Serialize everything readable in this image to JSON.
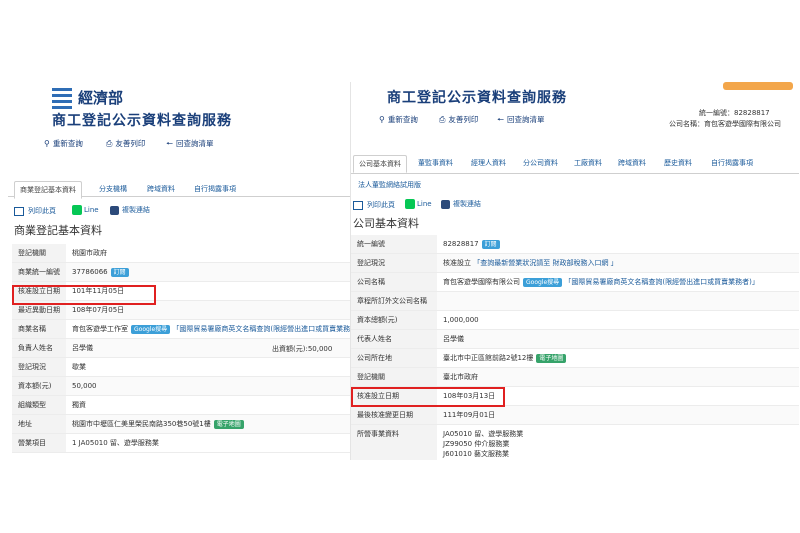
{
  "left": {
    "ministry": "經濟部",
    "service_title": "商工登記公示資料查詢服務",
    "toolbar": {
      "requery": "重新查詢",
      "friendly_print": "友善列印",
      "back_list": "回查詢清單"
    },
    "tabs": [
      "商業登記基本資料",
      "分支機構",
      "跨域資料",
      "自行揭露事項"
    ],
    "actions": {
      "print": "列印此頁",
      "line": "Line",
      "copy": "複製連結"
    },
    "section_title": "商業登記基本資料",
    "rows": [
      {
        "key": "登記機關",
        "value": "桃園市政府"
      },
      {
        "key": "商業統一編號",
        "value": "37786066",
        "badge": "訂閱"
      },
      {
        "key": "核准設立日期",
        "value": "101年11月05日"
      },
      {
        "key": "最近異動日期",
        "value": "108年07月05日"
      },
      {
        "key": "商業名稱",
        "value": "育包客遊學工作室",
        "badge": "Google搜尋",
        "extra": "「國際貿易署廠商英文名稱查詢(限經營出進口或買賣業務者)」"
      },
      {
        "key": "負責人姓名",
        "value": "呂學儀",
        "extra": "出資額(元):50,000"
      },
      {
        "key": "登記現況",
        "value": "歇業"
      },
      {
        "key": "資本額(元)",
        "value": "50,000"
      },
      {
        "key": "組織類型",
        "value": "獨資"
      },
      {
        "key": "地址",
        "value": "桃園市中壢區仁美里榮民南路350巷50號1樓",
        "badge": "電子地圖"
      },
      {
        "key": "營業項目",
        "value": "1 JA05010 留、遊學服務業"
      }
    ]
  },
  "right": {
    "service_title": "商工登記公示資料查詢服務",
    "toolbar": {
      "requery": "重新查詢",
      "friendly_print": "友善列印",
      "back_list": "回查詢清單"
    },
    "header_info": {
      "id_label": "統一編號：82828817",
      "name_label": "公司名稱：育包客遊學國際有限公司"
    },
    "tabs": [
      "公司基本資料",
      "董監事資料",
      "經理人資料",
      "分公司資料",
      "工廠資料",
      "跨域資料",
      "歷史資料",
      "自行揭露事項",
      "法人董監網絡試用版"
    ],
    "actions": {
      "print": "列印此頁",
      "line": "Line",
      "copy": "複製連結"
    },
    "section_title": "公司基本資料",
    "rows": [
      {
        "key": "統一編號",
        "value": "82828817",
        "badge": "訂閱"
      },
      {
        "key": "登記現況",
        "value": "核准設立",
        "extra": "「查詢最新營業狀況請至 財政部稅務入口網 」"
      },
      {
        "key": "公司名稱",
        "value": "育包客遊學國際有限公司",
        "badge": "Google搜尋",
        "extra": "「國際貿易署廠商英文名稱查詢(限經營出進口或買賣業務者)」"
      },
      {
        "key": "章程所訂外文公司名稱",
        "value": ""
      },
      {
        "key": "資本總額(元)",
        "value": "1,000,000"
      },
      {
        "key": "代表人姓名",
        "value": "呂學儀"
      },
      {
        "key": "公司所在地",
        "value": "臺北市中正區館前路2號12樓",
        "badge": "電子地圖"
      },
      {
        "key": "登記機關",
        "value": "臺北市政府"
      },
      {
        "key": "核准設立日期",
        "value": "108年03月13日"
      },
      {
        "key": "最後核准變更日期",
        "value": "111年09月01日"
      },
      {
        "key": "所營事業資料",
        "value": "JA05010 留、遊學服務業",
        "value2": "JZ99050 仲介服務業",
        "value3": "J601010 藝文服務業"
      }
    ]
  },
  "colors": {
    "accent": "#1a3f7a",
    "badge": "#3c9fd8",
    "highlight": "#e02020",
    "line": "#06c755"
  }
}
